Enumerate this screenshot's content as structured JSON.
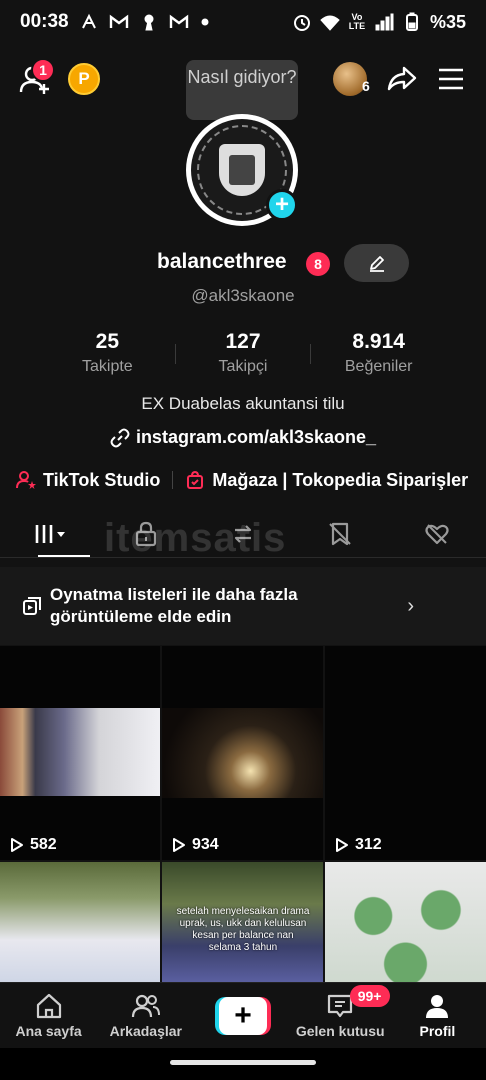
{
  "status_bar": {
    "time": "00:38",
    "battery": "%35",
    "network_label": "Vo LTE"
  },
  "top_bar": {
    "notification_count": "1",
    "coin_label": "P",
    "tooltip": "Nasıl gidiyor?",
    "story_count": "6"
  },
  "profile": {
    "username": "balancethree",
    "username_badge": "8",
    "handle": "@akl3skaone",
    "stats": [
      {
        "value": "25",
        "label": "Takipte"
      },
      {
        "value": "127",
        "label": "Takipçi"
      },
      {
        "value": "8.914",
        "label": "Beğeniler"
      }
    ],
    "bio": "EX Duabelas akuntansi tilu",
    "link": "instagram.com/akl3skaone_"
  },
  "shortcuts": [
    {
      "label": "TikTok Studio"
    },
    {
      "label": "Mağaza | Tokopedia Siparişler"
    }
  ],
  "watermark": "itemsatis",
  "playlist_banner": {
    "text": "Oynatma listeleri ile daha fazla görüntüleme elde edin"
  },
  "videos": [
    {
      "views": "582"
    },
    {
      "views": "934"
    },
    {
      "views": "312"
    },
    {
      "views": ""
    },
    {
      "views": "",
      "overlay": "setelah menyelesaikan drama uprak, us, ukk dan kelulusan kesan per balance nan selama 3 tahun"
    },
    {
      "views": ""
    }
  ],
  "bottom_nav": {
    "home": "Ana sayfa",
    "friends": "Arkadaşlar",
    "create": "+",
    "inbox": "Gelen kutusu",
    "inbox_badge": "99+",
    "profile": "Profil"
  },
  "colors": {
    "accent_red": "#fe2c55",
    "accent_cyan": "#20d5ec",
    "background": "#121212"
  }
}
